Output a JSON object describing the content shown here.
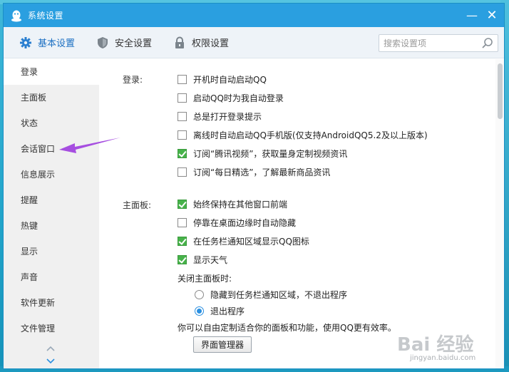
{
  "window": {
    "title": "系统设置",
    "minimize": "—",
    "close": "✕"
  },
  "tabs": [
    {
      "label": "基本设置",
      "icon": "gear-icon",
      "active": true
    },
    {
      "label": "安全设置",
      "icon": "shield-icon",
      "active": false
    },
    {
      "label": "权限设置",
      "icon": "lock-icon",
      "active": false
    }
  ],
  "search": {
    "placeholder": "搜索设置项",
    "value": ""
  },
  "sidebar": {
    "items": [
      {
        "label": "登录"
      },
      {
        "label": "主面板"
      },
      {
        "label": "状态"
      },
      {
        "label": "会话窗口"
      },
      {
        "label": "信息展示"
      },
      {
        "label": "提醒"
      },
      {
        "label": "热键"
      },
      {
        "label": "显示"
      },
      {
        "label": "声音"
      },
      {
        "label": "软件更新"
      },
      {
        "label": "文件管理"
      }
    ]
  },
  "login": {
    "label": "登录:",
    "options": [
      {
        "label": "开机时自动启动QQ",
        "checked": false
      },
      {
        "label": "启动QQ时为我自动登录",
        "checked": false
      },
      {
        "label": "总是打开登录提示",
        "checked": false
      },
      {
        "label": "离线时自动启动QQ手机版(仅支持AndroidQQ5.2及以上版本)",
        "checked": false
      },
      {
        "label": "订阅“腾讯视频”，获取量身定制视频资讯",
        "checked": true
      },
      {
        "label": "订阅“每日精选”，了解最新商品资讯",
        "checked": false
      }
    ]
  },
  "main_panel": {
    "label": "主面板:",
    "options": [
      {
        "label": "始终保持在其他窗口前端",
        "checked": true
      },
      {
        "label": "停靠在桌面边缘时自动隐藏",
        "checked": false
      },
      {
        "label": "在任务栏通知区域显示QQ图标",
        "checked": true
      },
      {
        "label": "显示天气",
        "checked": true
      }
    ],
    "close_label": "关闭主面板时:",
    "close_options": [
      {
        "label": "隐藏到任务栏通知区域，不退出程序",
        "checked": false
      },
      {
        "label": "退出程序",
        "checked": true
      }
    ],
    "note": "你可以自由定制适合你的面板和功能，使用QQ更有效率。",
    "manager_button": "界面管理器"
  },
  "watermark": {
    "logo": "Bai 经验",
    "url": "jingyan.baidu.com"
  },
  "colors": {
    "titlebar": "#2a9fe0",
    "accent": "#1b6fc2",
    "check_green": "#47b24a",
    "arrow": "#a64ee0"
  }
}
